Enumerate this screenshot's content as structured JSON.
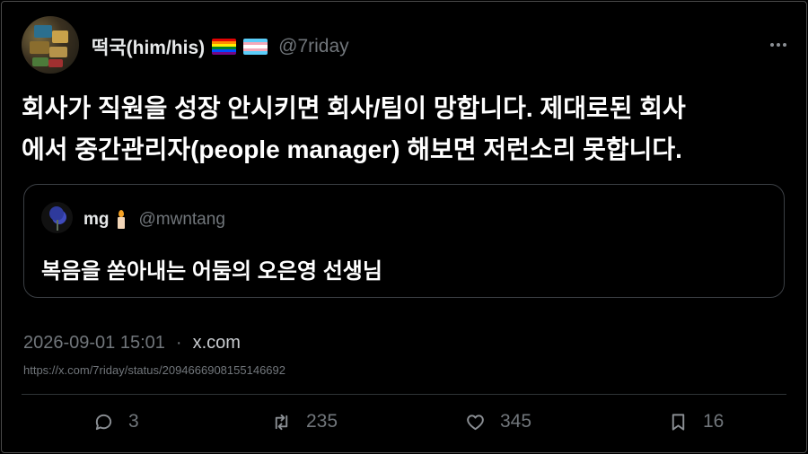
{
  "tweet": {
    "author": {
      "name": "떡국(him/his)",
      "handle": "@7riday",
      "flags": [
        "rainbow-flag",
        "transgender-flag"
      ]
    },
    "text_lines": [
      "회사가 직원을 성장 안시키면 회사/팀이 망합니다. 제대로된 회사",
      "에서 중간관리자(people manager) 해보면 저런소리 못합니다."
    ],
    "quoted": {
      "name": "mg",
      "emoji": "candle",
      "handle": "@mwntang",
      "text": "복음을 쏟아내는 어둠의 오은영 선생님"
    },
    "timestamp": "2026-09-01 15:01",
    "separator": "·",
    "source": "x.com",
    "url": "https://x.com/7riday/status/2094666908155146692",
    "actions": {
      "replies": "3",
      "retweets": "235",
      "likes": "345",
      "bookmarks": "16"
    }
  },
  "icons": {
    "more": "more-horizontal-icon",
    "reply": "reply-icon",
    "retweet": "retweet-icon",
    "like": "heart-icon",
    "bookmark": "bookmark-icon"
  },
  "colors": {
    "background": "#000000",
    "text": "#e7e9ea",
    "muted": "#71767b",
    "border": "#2f3336"
  }
}
